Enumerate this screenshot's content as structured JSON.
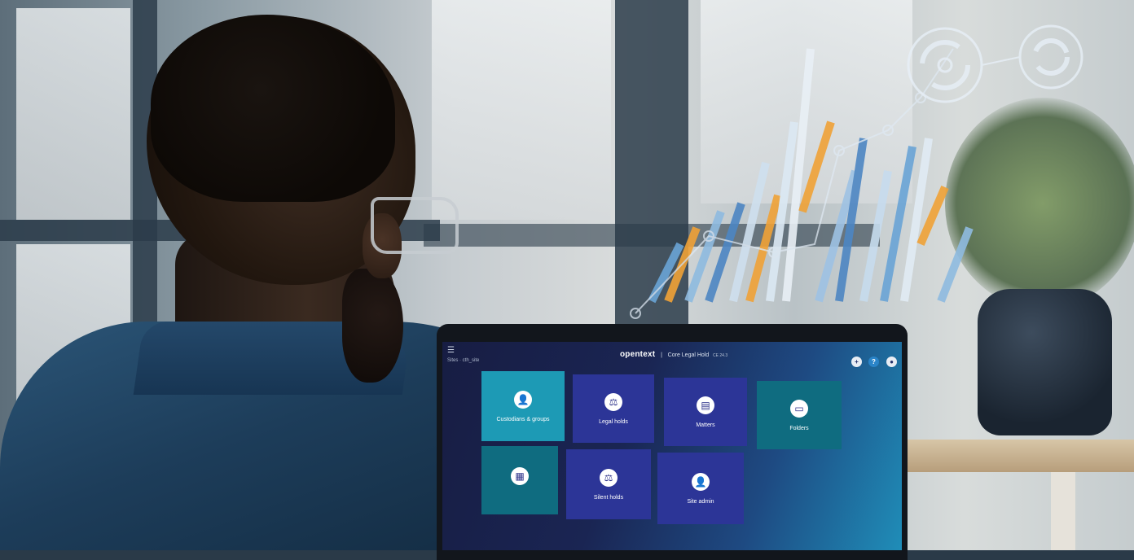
{
  "app": {
    "brand": "opentext",
    "separator": "|",
    "product": "Core Legal Hold",
    "version": "CE 24.3",
    "breadcrumb": "Sites  ·  cth_site"
  },
  "header": {
    "menu_icon": "hamburger-icon",
    "add_icon": "plus-icon",
    "add_symbol": "+",
    "help_icon": "help-icon",
    "help_symbol": "?",
    "user_icon": "user-icon",
    "user_symbol": "●"
  },
  "tiles": [
    {
      "label": "Custodians & groups",
      "icon": "custodians-icon",
      "glyph": "👤",
      "color": "#1d9ab5"
    },
    {
      "label": "Legal holds",
      "icon": "legal-hold-icon",
      "glyph": "⚖",
      "color": "#2c3597"
    },
    {
      "label": "Matters",
      "icon": "matters-icon",
      "glyph": "▤",
      "color": "#2c3597"
    },
    {
      "label": "Folders",
      "icon": "folder-icon",
      "glyph": "▭",
      "color": "#0f6c80"
    },
    {
      "label": "",
      "icon": "reports-icon",
      "glyph": "▦",
      "color": "#0f6c80"
    },
    {
      "label": "Silent holds",
      "icon": "silent-hold-icon",
      "glyph": "⚖",
      "color": "#2c3597"
    },
    {
      "label": "Site admin",
      "icon": "admin-icon",
      "glyph": "👤",
      "color": "#2c3597"
    }
  ]
}
